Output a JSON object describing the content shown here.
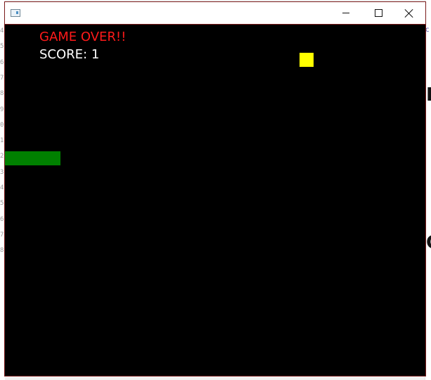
{
  "window": {
    "title": ""
  },
  "game": {
    "status_text": "GAME OVER!!",
    "score_text": "SCORE: 1",
    "colors": {
      "background": "#000000",
      "status": "#ff1a1a",
      "score": "#ffffff",
      "food": "#ffff00",
      "snake": "#008000"
    }
  },
  "background_gutter": [
    "4",
    "5",
    "6",
    "7",
    "8",
    "9",
    "0",
    "1",
    "2",
    "3",
    "4",
    "5",
    "6",
    "7",
    "8"
  ]
}
